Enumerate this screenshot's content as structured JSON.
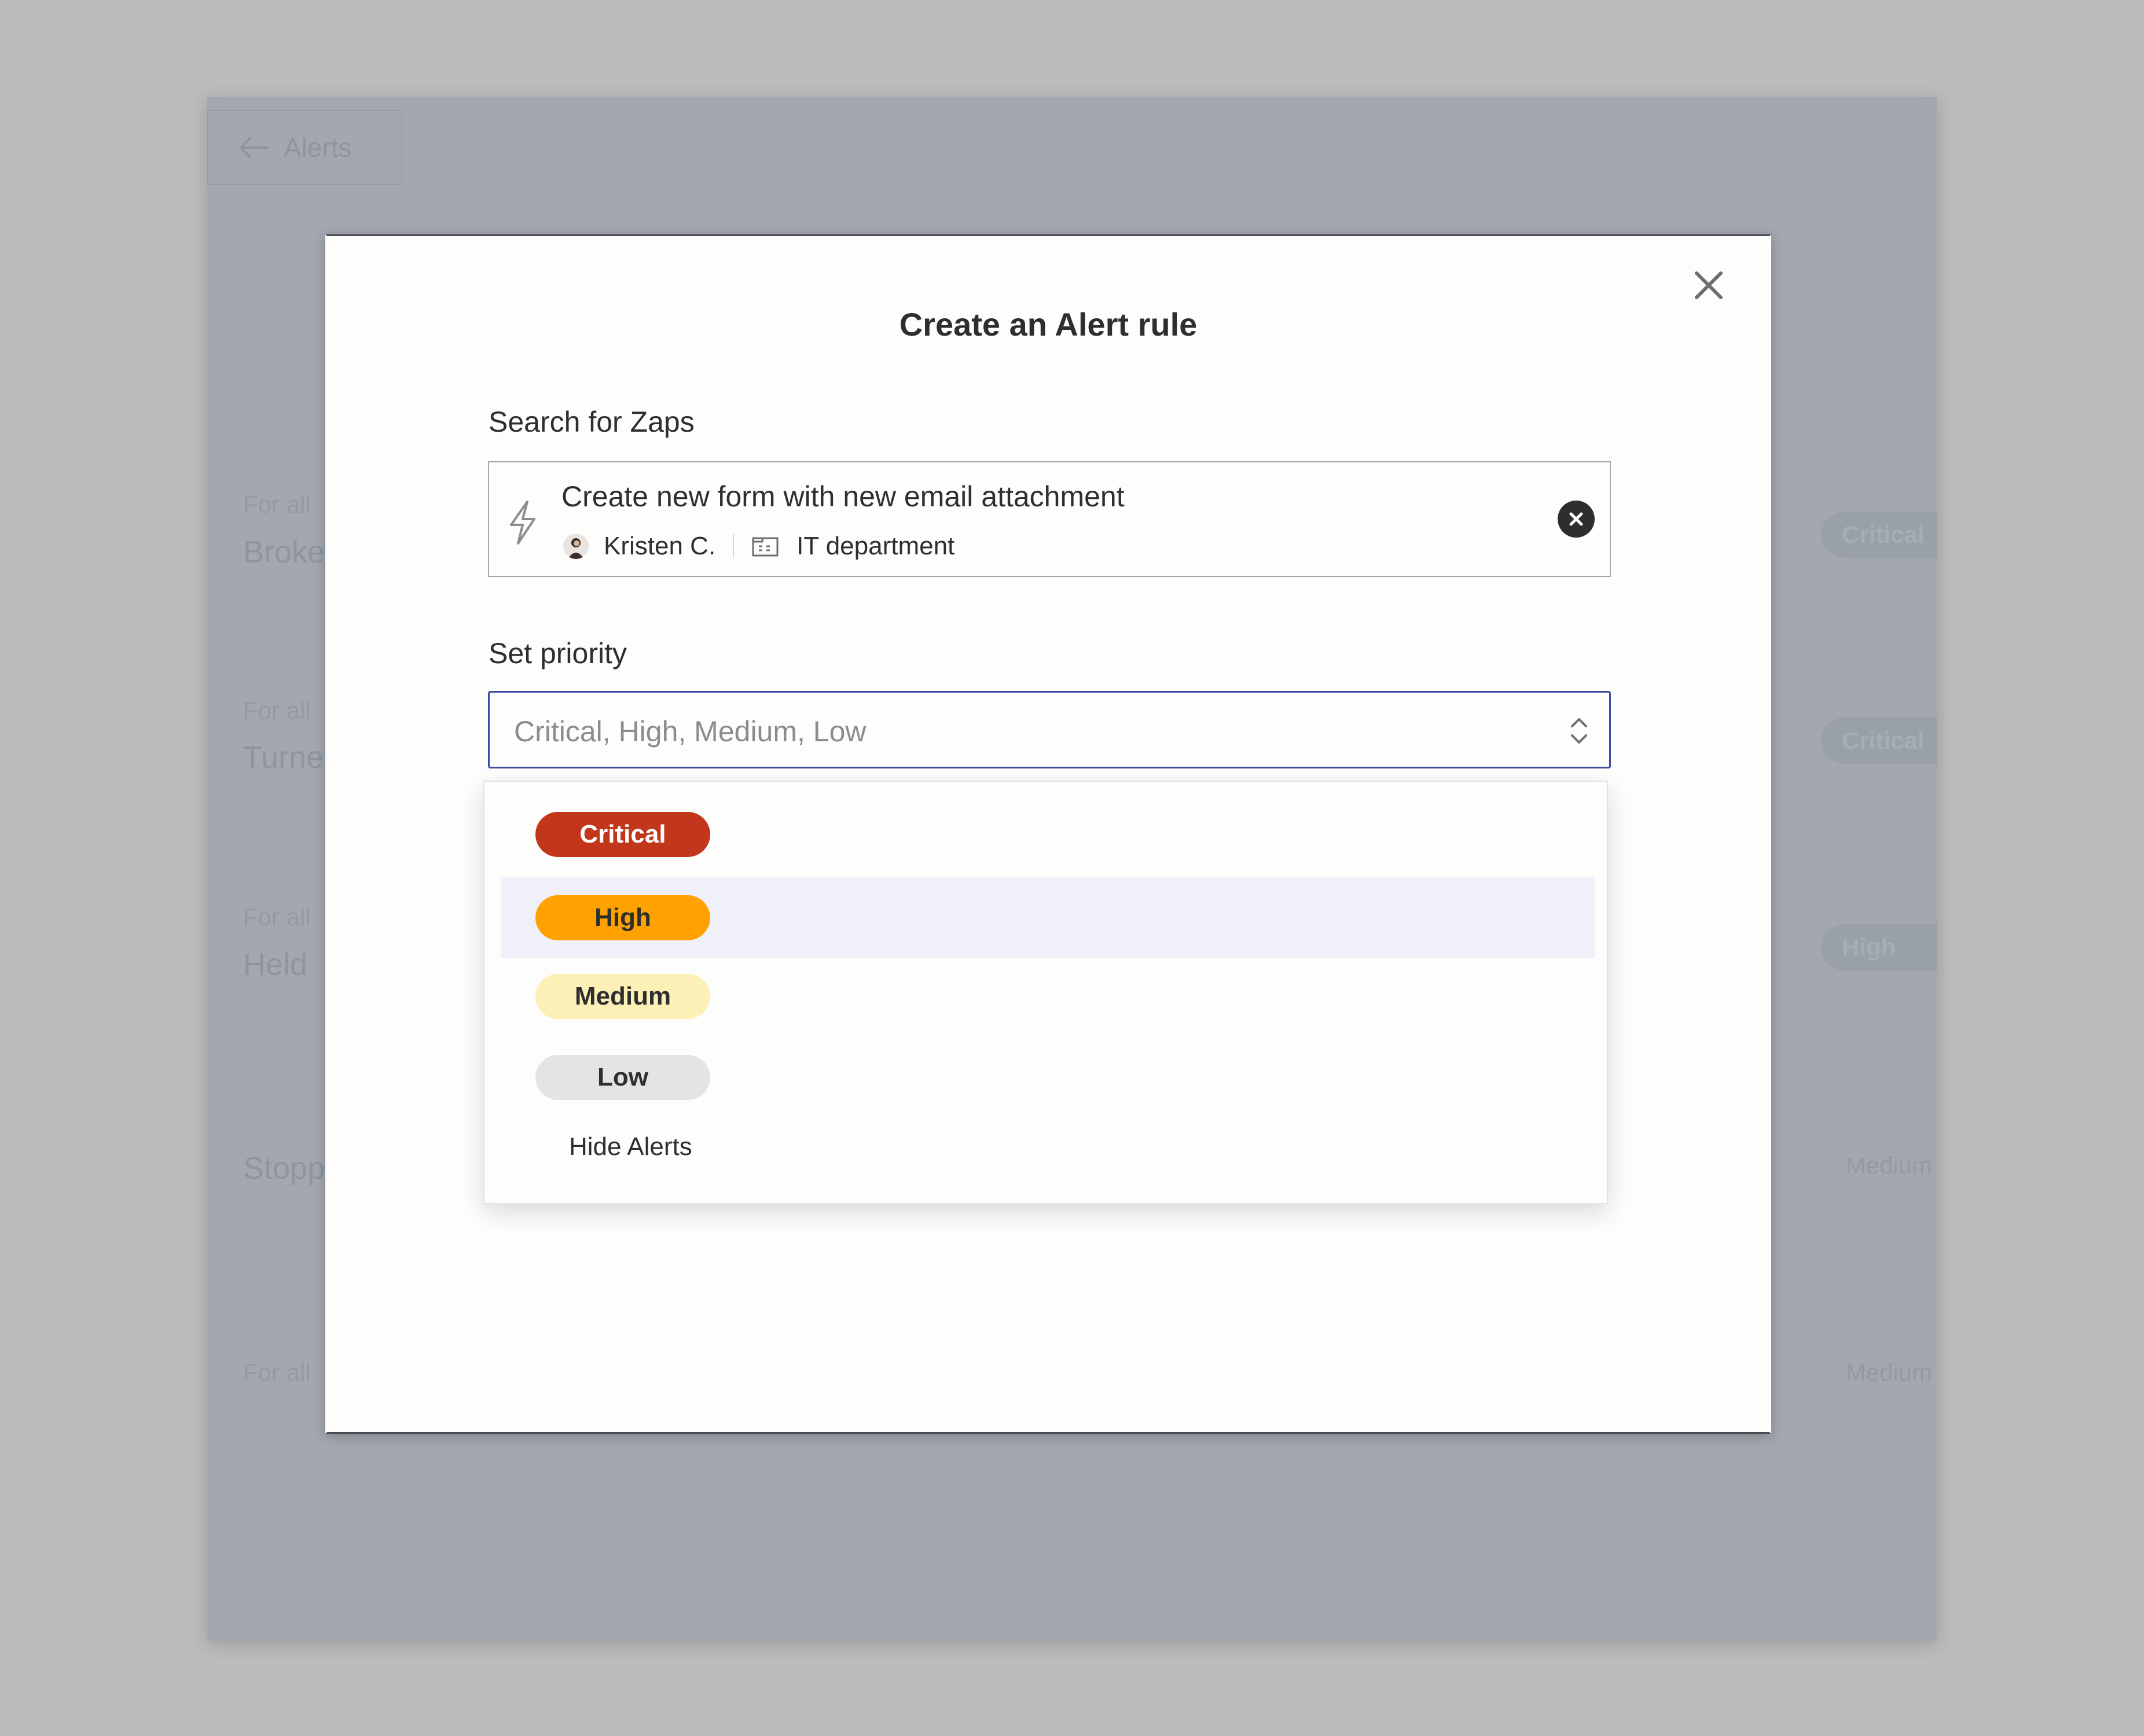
{
  "background_page": {
    "back_label": "Alerts",
    "rows": [
      {
        "label": "For all",
        "title": "Broke",
        "badge": "Critical"
      },
      {
        "label": "For all",
        "title": "Turne",
        "badge": "Critical"
      },
      {
        "label": "For all",
        "title": "Held",
        "badge": "High"
      },
      {
        "label": "",
        "title": "Stopp",
        "badge": "Medium"
      },
      {
        "label": "For all",
        "title": "",
        "badge": "Medium"
      }
    ]
  },
  "modal": {
    "title": "Create an Alert rule",
    "close_icon": "close-icon",
    "search": {
      "label": "Search for Zaps",
      "zap_title": "Create new form with new email attachment",
      "owner": "Kristen C.",
      "folder": "IT department",
      "icon": "bolt-icon"
    },
    "priority": {
      "label": "Set priority",
      "placeholder": "Critical, High, Medium, Low"
    }
  },
  "dropdown": {
    "options": [
      {
        "label": "Critical",
        "bg": "#c2361b",
        "fg": "#ffffff"
      },
      {
        "label": "High",
        "bg": "#ffa100",
        "fg": "#2d2e2e",
        "highlighted": true
      },
      {
        "label": "Medium",
        "bg": "#fdf0b6",
        "fg": "#2d2e2e"
      },
      {
        "label": "Low",
        "bg": "#e4e4e4",
        "fg": "#2d2e2e"
      }
    ],
    "hide_alerts": "Hide Alerts"
  },
  "colors": {
    "accent": "#3d4ea1",
    "text": "#2d2e2e",
    "highlight_row": "#eff0f8"
  }
}
